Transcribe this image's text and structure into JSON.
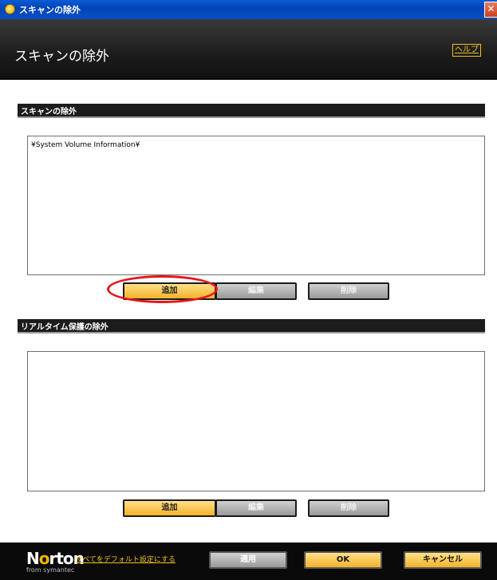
{
  "window": {
    "title": "スキャンの除外",
    "close_glyph": "✕"
  },
  "banner": {
    "heading": "スキャンの除外",
    "help_link": "ヘルプ"
  },
  "scan_exclusions": {
    "header": "スキャンの除外",
    "items": [
      "¥System Volume Information¥"
    ],
    "buttons": {
      "add": "追加",
      "edit": "編集",
      "delete": "削除"
    }
  },
  "realtime_exclusions": {
    "header": "リアルタイム保護の除外",
    "items": [],
    "buttons": {
      "add": "追加",
      "edit": "編集",
      "delete": "削除"
    }
  },
  "footer": {
    "logo_prefix": "N",
    "logo_o": "o",
    "logo_suffix": "rton",
    "logo_sub": "from symantec",
    "reset_link": "すべてをデフォルト設定にする",
    "apply_button": "適用",
    "ok_button": "OK",
    "cancel_button": "キャンセル"
  },
  "colors": {
    "accent": "#f2b22a",
    "highlight": "#e8141a",
    "titlebar": "#0244b8"
  }
}
